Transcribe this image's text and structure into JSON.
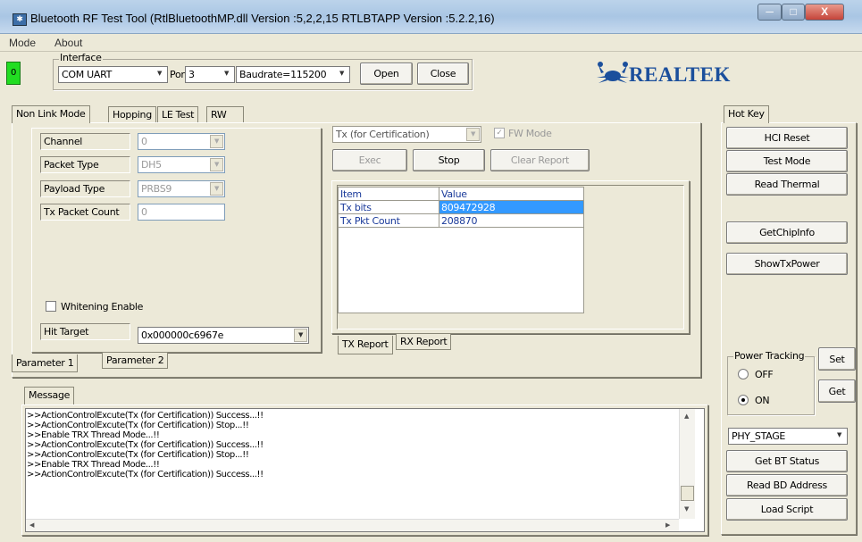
{
  "window": {
    "title": "Bluetooth RF Test Tool (RtlBluetoothMP.dll Version :5,2,2,15   RTLBTAPP Version :5.2.2,16)",
    "minimize": "─",
    "maximize": "□",
    "close": "X"
  },
  "menu": [
    "Mode",
    "About"
  ],
  "status_indicator": "0",
  "interface": {
    "legend": "Interface",
    "type": "COM UART",
    "port_label": "Port",
    "port": "3",
    "baudrate": "Baudrate=115200",
    "open": "Open",
    "close": "Close"
  },
  "logo": "REALTEK",
  "tabs": [
    "Non Link Mode",
    "Hopping",
    "LE Test",
    "RW"
  ],
  "params": {
    "channel_label": "Channel",
    "channel": "0",
    "packet_type_label": "Packet Type",
    "packet_type": "DH5",
    "payload_type_label": "Payload Type",
    "payload_type": "PRBS9",
    "tx_count_label": "Tx Packet Count",
    "tx_count": "0",
    "whitening_label": "Whitening Enable",
    "hit_target_label": "Hit Target",
    "hit_target": "0x000000c6967e",
    "tab1": "Parameter 1",
    "tab2": "Parameter 2"
  },
  "test": {
    "mode": "Tx (for Certification)",
    "fw_mode": "FW Mode",
    "exec": "Exec",
    "stop": "Stop",
    "clear": "Clear Report"
  },
  "report": {
    "headers": [
      "Item",
      "Value"
    ],
    "rows": [
      {
        "item": "Tx bits",
        "value": "809472928"
      },
      {
        "item": "Tx Pkt Count",
        "value": "208870"
      }
    ],
    "tab_tx": "TX Report",
    "tab_rx": "RX Report"
  },
  "hotkey": {
    "tab": "Hot Key",
    "hci_reset": "HCI Reset",
    "test_mode": "Test Mode",
    "read_thermal": "Read Thermal",
    "get_chip_info": "GetChipInfo",
    "show_tx_power": "ShowTxPower",
    "power_tracking": "Power Tracking",
    "off": "OFF",
    "on": "ON",
    "set": "Set",
    "get": "Get",
    "phy_stage": "PHY_STAGE",
    "get_bt_status": "Get BT Status",
    "read_bd_address": "Read BD Address",
    "load_script": "Load Script"
  },
  "message": {
    "tab": "Message",
    "lines": [
      ">>ActionControlExcute(Tx (for Certification)) Success...!!",
      ">>ActionControlExcute(Tx (for Certification)) Stop...!!",
      ">>Enable TRX Thread Mode...!!",
      ">>ActionControlExcute(Tx (for Certification)) Success...!!",
      ">>ActionControlExcute(Tx (for Certification)) Stop...!!",
      ">>Enable TRX Thread Mode...!!",
      ">>ActionControlExcute(Tx (for Certification)) Success...!!"
    ]
  },
  "colors": {
    "indicator": "#22dd22",
    "selection": "#3399ff",
    "logo": "#1b4f9c"
  }
}
